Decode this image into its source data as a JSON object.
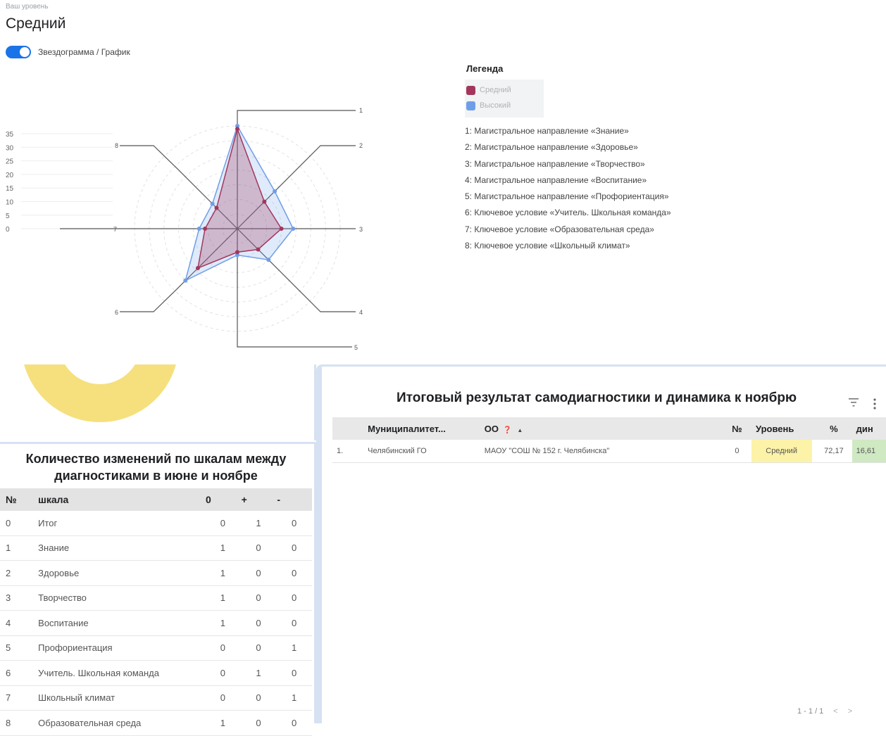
{
  "level": {
    "caption": "Ваш уровень",
    "value": "Средний"
  },
  "toggle": {
    "label": "Звездограмма / График",
    "on": true
  },
  "legend": {
    "title": "Легенда",
    "series": [
      {
        "name": "Средний",
        "color": "#a3365c"
      },
      {
        "name": "Высокий",
        "color": "#6f9ee8"
      }
    ],
    "axes": [
      "1: Магистральное направление «Знание»",
      "2: Магистральное направление «Здоровье»",
      "3: Магистральное направление «Творчество»",
      "4: Магистральное направление «Воспитание»",
      "5: Магистральное направление «Профориентация»",
      "6: Ключевое условие «Учитель. Школьная команда»",
      "7: Ключевое условие «Образовательная среда»",
      "8: Ключевое условие «Школьный климат»"
    ]
  },
  "chart_data": {
    "type": "radar",
    "axes": [
      "1",
      "2",
      "3",
      "4",
      "5",
      "6",
      "7",
      "8"
    ],
    "scale_ticks": [
      "35",
      "30",
      "25",
      "20",
      "15",
      "10",
      "5",
      "0"
    ],
    "range": [
      0,
      35
    ],
    "series": [
      {
        "name": "Средний",
        "color": "#a3365c",
        "values": [
          34,
          13,
          15,
          10,
          8,
          19,
          11,
          10
        ]
      },
      {
        "name": "Высокий",
        "color": "#6f9ee8",
        "values": [
          35,
          18,
          19,
          15,
          9,
          25,
          13,
          12
        ]
      }
    ]
  },
  "left_table": {
    "title": "Количество изменений по шкалам между диагностиками в июне и ноябре",
    "columns": [
      "№",
      "шкала",
      "0",
      "+",
      "-"
    ],
    "rows": [
      [
        "0",
        "Итог",
        "0",
        "1",
        "0"
      ],
      [
        "1",
        "Знание",
        "1",
        "0",
        "0"
      ],
      [
        "2",
        "Здоровье",
        "1",
        "0",
        "0"
      ],
      [
        "3",
        "Творчество",
        "1",
        "0",
        "0"
      ],
      [
        "4",
        "Воспитание",
        "1",
        "0",
        "0"
      ],
      [
        "5",
        "Профориентация",
        "0",
        "0",
        "1"
      ],
      [
        "6",
        "Учитель. Школьная команда",
        "0",
        "1",
        "0"
      ],
      [
        "7",
        "Школьный климат",
        "0",
        "0",
        "1"
      ],
      [
        "8",
        "Образовательная среда",
        "1",
        "0",
        "0"
      ]
    ]
  },
  "right_table": {
    "title": "Итоговый результат самодиагностики и динамика к ноябрю",
    "columns": [
      "",
      "Муниципалитет...",
      "ОО",
      "№",
      "Уровень",
      "%",
      "дин"
    ],
    "sort_indicator": "▲",
    "rows": [
      [
        "1.",
        "Челябинский ГО",
        "МАОУ \"СОШ № 152 г. Челябинска\"",
        "0",
        "Средний",
        "72,17",
        "16,61"
      ]
    ],
    "level_color": "#fdf3a8",
    "dyn_color": "#cfe9c2",
    "pager": {
      "range": "1 - 1 / 1",
      "prev": "<",
      "next": ">"
    }
  },
  "icons": {
    "filter": "filter-icon",
    "more": "more-vert-icon",
    "help": "help-icon",
    "donut": "donut-chart-fragment"
  },
  "colors": {
    "accent": "#1a73e8",
    "donut": "#f5e07d",
    "panel_border": "#d6e2f2"
  }
}
